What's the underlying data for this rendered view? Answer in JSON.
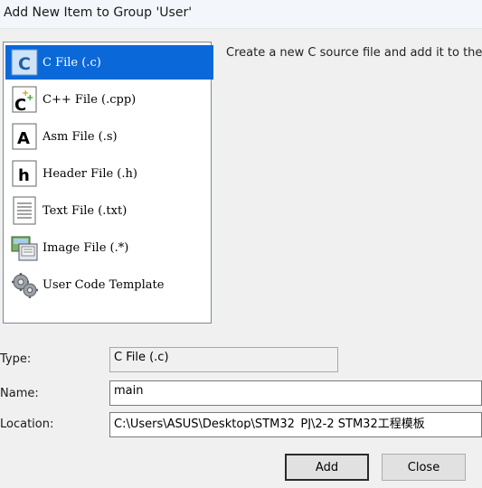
{
  "window": {
    "title": "Add New Item to Group 'User'"
  },
  "templates": {
    "items": [
      {
        "label": "C File (.c)",
        "icon": "c-file-icon",
        "selected": true
      },
      {
        "label": "C++ File (.cpp)",
        "icon": "cpp-file-icon",
        "selected": false
      },
      {
        "label": "Asm File (.s)",
        "icon": "asm-file-icon",
        "selected": false
      },
      {
        "label": "Header File (.h)",
        "icon": "header-file-icon",
        "selected": false
      },
      {
        "label": "Text File (.txt)",
        "icon": "text-file-icon",
        "selected": false
      },
      {
        "label": "Image File (.*)",
        "icon": "image-file-icon",
        "selected": false
      },
      {
        "label": "User Code Template",
        "icon": "gear-icon",
        "selected": false
      }
    ]
  },
  "description": "Create a new C source file and add it to the pro",
  "form": {
    "type_label": "Type:",
    "type_value": "C File (.c)",
    "name_label": "Name:",
    "name_value": "main",
    "location_label": "Location:",
    "location_value": "C:\\Users\\ASUS\\Desktop\\STM32_PJ\\2-2 STM32工程模板"
  },
  "buttons": {
    "add": "Add",
    "close": "Close"
  },
  "colors": {
    "selection": "#0a68d8",
    "dialog_bg": "#f0f0f0"
  }
}
